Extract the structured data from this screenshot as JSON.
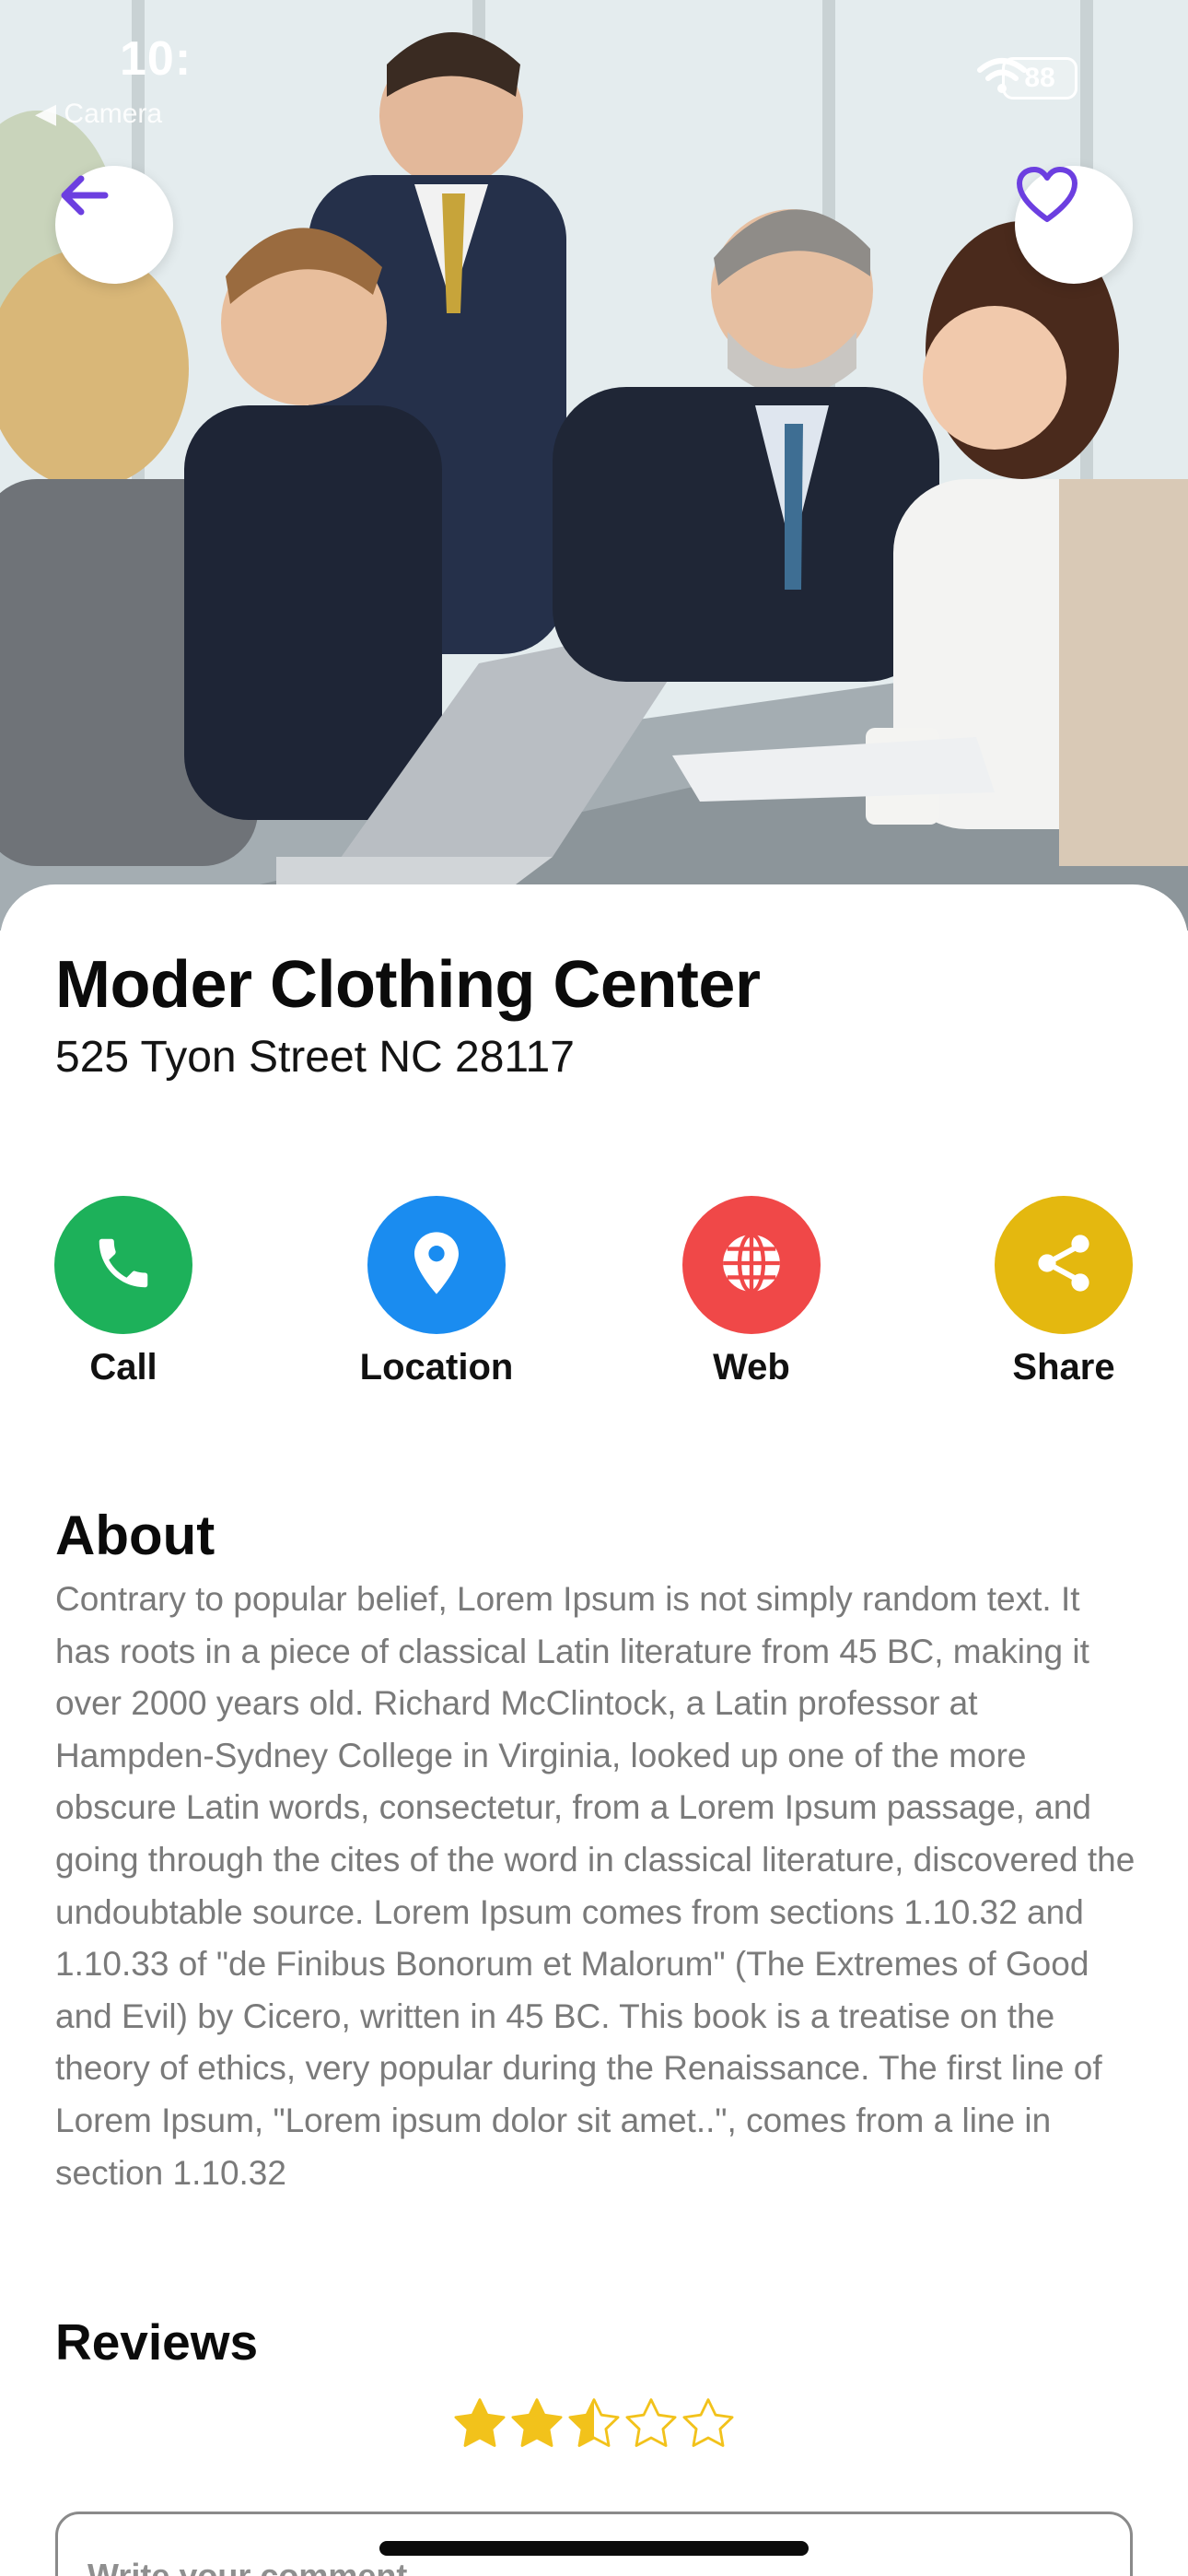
{
  "status_bar": {
    "time": "10:",
    "back_app": "◀ Camera",
    "battery": "88"
  },
  "hero": {
    "back_icon": "arrow-left-icon",
    "favorite_icon": "heart-icon",
    "accent": "#6C3FE0"
  },
  "place": {
    "name": "Moder Clothing Center",
    "address": "525 Tyon Street NC 28117"
  },
  "actions": [
    {
      "label": "Call",
      "icon": "phone-icon",
      "color": "#1DB15A"
    },
    {
      "label": "Location",
      "icon": "location-pin-icon",
      "color": "#1A8CF0"
    },
    {
      "label": "Web",
      "icon": "globe-icon",
      "color": "#F04848"
    },
    {
      "label": "Share",
      "icon": "share-icon",
      "color": "#E4B80F"
    }
  ],
  "about": {
    "heading": "About",
    "text": "Contrary to popular belief, Lorem Ipsum is not simply random text. It has roots in a piece of classical Latin literature from 45 BC, making it over 2000 years old. Richard McClintock, a Latin professor at Hampden-Sydney College in Virginia, looked up one of the more obscure Latin words, consectetur, from a Lorem Ipsum passage, and going through the cites of the word in classical literature, discovered the undoubtable source. Lorem Ipsum comes from sections 1.10.32 and 1.10.33 of \"de Finibus Bonorum et Malorum\" (The Extremes of Good and Evil) by Cicero, written in 45 BC. This book is a treatise on the theory of ethics, very popular during the Renaissance. The first line of Lorem Ipsum, \"Lorem ipsum dolor sit amet..\", comes from a line in section 1.10.32"
  },
  "reviews": {
    "heading": "Reviews",
    "rating": 2.5,
    "max_rating": 5,
    "star_color": "#F2C21B",
    "comment_placeholder": "Write your comment"
  }
}
